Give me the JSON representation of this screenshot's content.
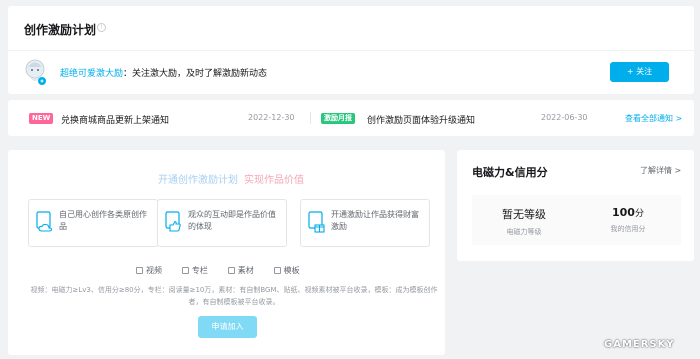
{
  "header": {
    "title": "创作激励计划",
    "info_icon": "info-icon",
    "promo_name": "超绝可爱激大励",
    "promo_text": "：关注激大励，及时了解激励新动态",
    "follow_label": "+ 关注"
  },
  "notices": [
    {
      "tag": "NEW",
      "tag_color": "#ff6699",
      "text": "兑换商城商品更新上架通知",
      "date": "2022-12-30"
    },
    {
      "tag": "激励月报",
      "tag_color": "#2ac67e",
      "text": "创作激励页面体验升级通知",
      "date": "2022-06-30"
    }
  ],
  "notice_more": "查看全部通知 >",
  "join": {
    "headline": "开通创作激励计划",
    "headline_highlight": "实现作品价值",
    "features": [
      {
        "icon": "cloud-upload-icon",
        "text": "自己用心创作各类原创作品"
      },
      {
        "icon": "thumbs-up-icon",
        "text": "观众的互动即是作品价值的体现"
      },
      {
        "icon": "gift-icon",
        "text": "开通激励让作品获得财富激励"
      }
    ],
    "categories": [
      "视频",
      "专栏",
      "素材",
      "模板"
    ],
    "requirements": "视频：电磁力≥Lv3、信用分≥80分，专栏：阅读量≥10万，素材：有自制BGM、贴纸、视频素材被平台收录，模板：成为模板创作者，有自制模板被平台收录。",
    "apply_label": "申请加入"
  },
  "credit": {
    "title": "电磁力&信用分",
    "detail_label": "了解详情 >",
    "level_value": "暂无等级",
    "level_label": "电磁力等级",
    "score_value": "100",
    "score_unit": "分",
    "score_label": "我的信用分"
  },
  "watermark": "GAMERSKY",
  "colors": {
    "accent": "#00aeec",
    "pink": "#ff6699",
    "green": "#2ac67e"
  }
}
